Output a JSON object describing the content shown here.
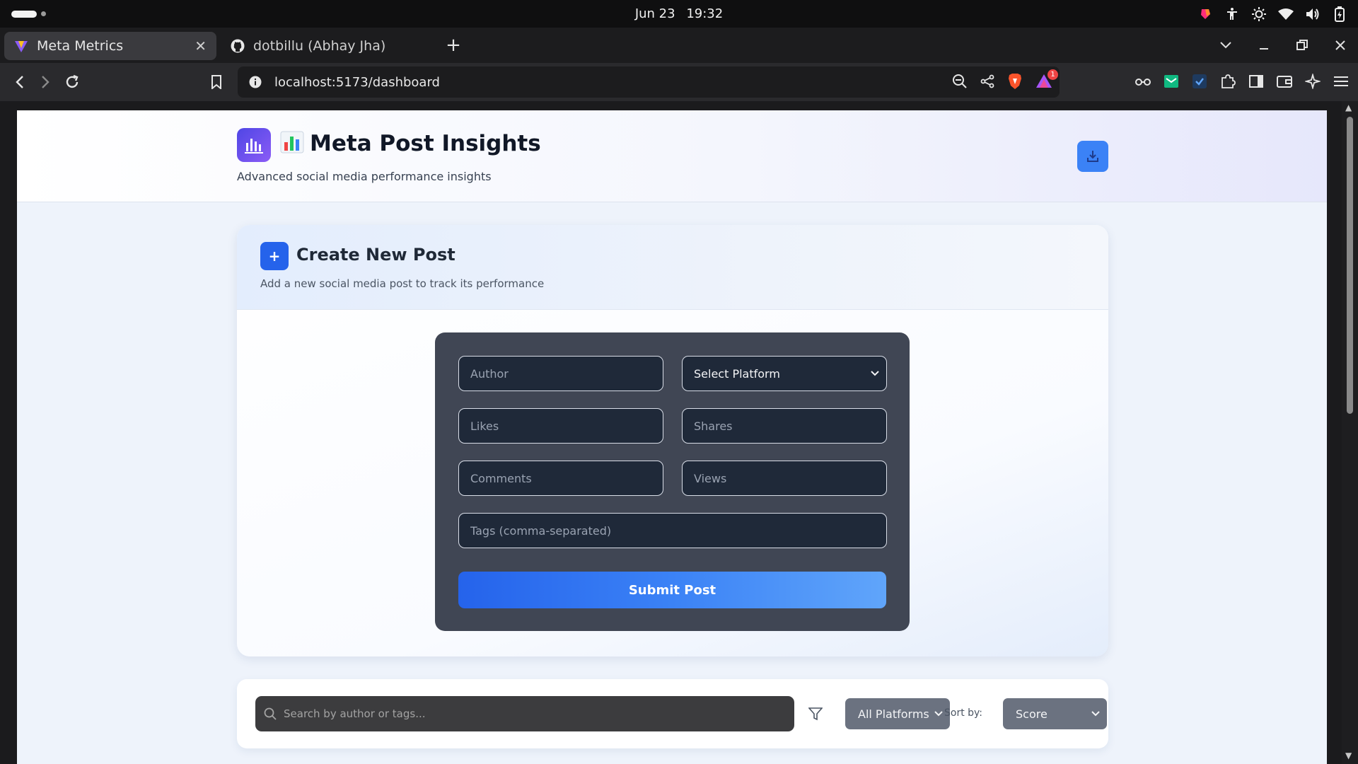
{
  "os": {
    "date": "Jun 23",
    "time": "19:32"
  },
  "browser": {
    "tabs": [
      {
        "title": "Meta Metrics",
        "icon": "vite-icon",
        "active": true
      },
      {
        "title": "dotbillu (Abhay Jha)",
        "icon": "github-icon",
        "active": false
      }
    ],
    "url": "localhost:5173/dashboard",
    "brave_rewards_badge": "1"
  },
  "app": {
    "title": "Meta Post Insights",
    "subtitle": "Advanced social media performance insights",
    "create_post": {
      "icon_label": "+",
      "title": "Create New Post",
      "description": "Add a new social media post to track its performance",
      "fields": {
        "author_placeholder": "Author",
        "platform_selected": "Select Platform",
        "likes_placeholder": "Likes",
        "shares_placeholder": "Shares",
        "comments_placeholder": "Comments",
        "views_placeholder": "Views",
        "tags_placeholder": "Tags (comma-separated)"
      },
      "submit_label": "Submit Post"
    },
    "filters": {
      "search_placeholder": "Search by author or tags...",
      "platform_selected": "All Platforms",
      "sort_label": "Sort by:",
      "sort_selected": "Score"
    }
  },
  "colors": {
    "accent": "#3b82f6",
    "primary_button": "#2563eb",
    "logo_gradient_start": "#4f46e5",
    "form_panel": "#404654"
  }
}
